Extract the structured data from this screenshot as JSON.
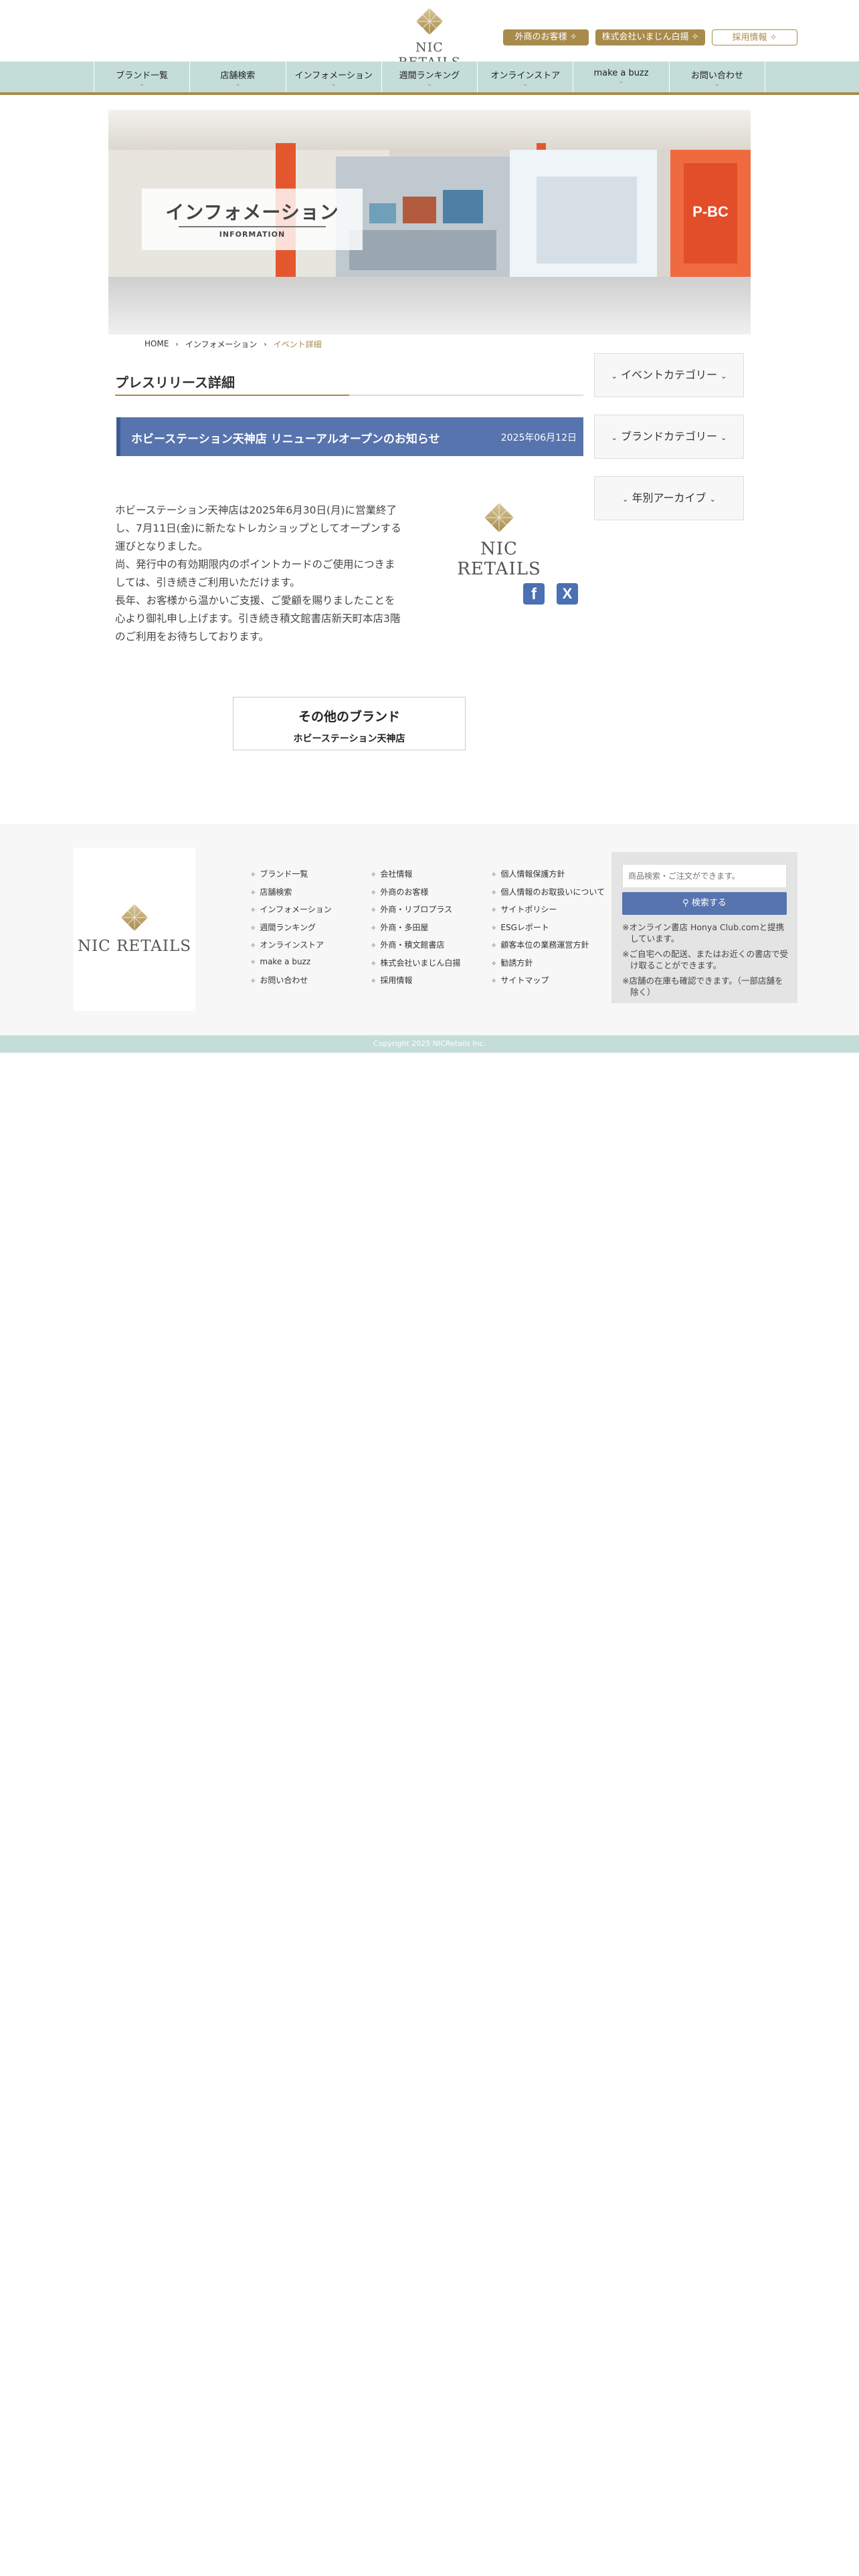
{
  "header": {
    "logo_text": "NIC RETAILS",
    "buttons": {
      "foreign": "外商のお客様",
      "company": "株式会社いまじん白揚",
      "recruit": "採用情報"
    }
  },
  "nav": {
    "items": [
      {
        "label": "ブランド一覧"
      },
      {
        "label": "店舗検索"
      },
      {
        "label": "インフォメーション"
      },
      {
        "label": "週間ランキング"
      },
      {
        "label": "オンラインストア"
      },
      {
        "label": "make a buzz"
      },
      {
        "label": "お問い合わせ"
      }
    ]
  },
  "hero": {
    "title": "インフォメーション",
    "subtitle": "INFORMATION",
    "store_sign": "P-BC"
  },
  "breadcrumb": {
    "home": "HOME",
    "info": "インフォメーション",
    "current": "イベント詳細"
  },
  "main": {
    "section_title": "プレスリリース詳細",
    "press": {
      "title": "ホビーステーション天神店 リニューアルオープンのお知らせ",
      "date": "2025年06月12日"
    },
    "body_lines": [
      "ホビーステーション天神店は2025年6月30日(月)に営業終了",
      "し、7月11日(金)に新たなトレカショップとしてオープンする",
      "運びとなりました。",
      "尚、発行中の有効期限内のポイントカードのご使用につきま",
      "しては、引き続きご利用いただけます。",
      "長年、お客様から温かいご支援、ご愛顧を賜りましたことを",
      "心より御礼申し上げます。引き続き積文館書店新天町本店3階",
      "のご利用をお待ちしております。"
    ],
    "brand_logo_text": "NIC RETAILS",
    "sns": {
      "facebook": "f",
      "x": "X"
    },
    "other_brand": {
      "title": "その他のブランド",
      "link": "ホビーステーション天神店"
    }
  },
  "sidebar": {
    "event_category": "イベントカテゴリー",
    "brand_category": "ブランドカテゴリー",
    "yearly_archive": "年別アーカイブ"
  },
  "footer": {
    "logo_text": "NIC RETAILS",
    "col1": [
      "ブランド一覧",
      "店舗検索",
      "インフォメーション",
      "週間ランキング",
      "オンラインストア",
      "make a buzz",
      "お問い合わせ"
    ],
    "col2": [
      "会社情報",
      "外商のお客様",
      "外商・リブロプラス",
      "外商・多田屋",
      "外商・積文館書店",
      "株式会社いまじん白揚",
      "採用情報"
    ],
    "col3": [
      "個人情報保護方針",
      "個人情報のお取扱いについて",
      "サイトポリシー",
      "ESGレポート",
      "顧客本位の業務運営方針",
      "勧誘方針",
      "サイトマップ"
    ],
    "search": {
      "placeholder": "商品検索・ご注文ができます。",
      "button": "検索する",
      "notes": [
        "※オンライン書店 Honya Club.comと提携しています。",
        "※ご自宅への配送、またはお近くの書店で受け取ることができます。",
        "※店舗の在庫も確認できます。（一部店舗を除く）"
      ]
    },
    "copyright": "Copyright 2025 NICRetails Inc."
  },
  "colors": {
    "accent_gold": "#a88a4a",
    "nav_teal": "#c4ddd8",
    "press_blue": "#5774ae"
  }
}
